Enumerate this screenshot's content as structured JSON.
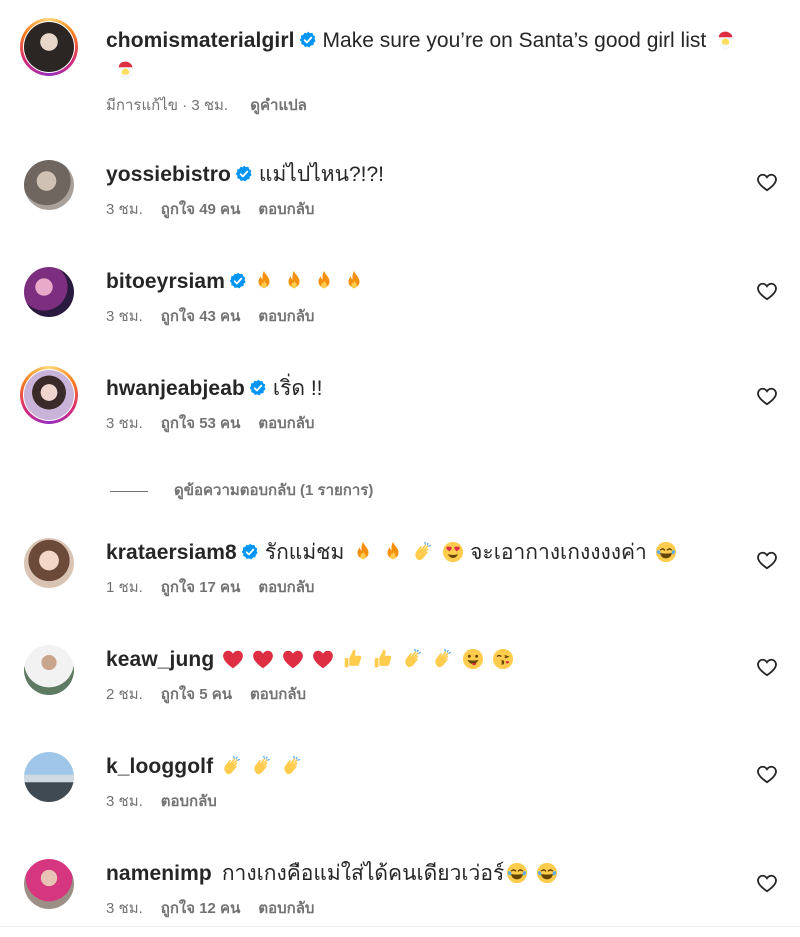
{
  "caption": {
    "username": "chomismaterialgirl",
    "text": "Make sure you’re on Santa’s good girl list",
    "edited": "มีการแก้ไข · 3 ชม.",
    "translate": "ดูคำแปล"
  },
  "comments": [
    {
      "username": "yossiebistro",
      "text": "แม่ไปไหน?!?!",
      "time": "3 ชม.",
      "likes": "ถูกใจ 49 คน",
      "reply": "ตอบกลับ",
      "verified": true
    },
    {
      "username": "bitoeyrsiam",
      "text": "",
      "time": "3 ชม.",
      "likes": "ถูกใจ 43 คน",
      "reply": "ตอบกลับ",
      "verified": true
    },
    {
      "username": "hwanjeabjeab",
      "text": "เริ่ด !!",
      "time": "3 ชม.",
      "likes": "ถูกใจ 53 คน",
      "reply": "ตอบกลับ",
      "verified": true
    },
    {
      "username": "krataersiam8",
      "text_a": "รักแม่ชม",
      "text_b": "จะเอากางเกงงงงค่า",
      "time": "1 ชม.",
      "likes": "ถูกใจ 17 คน",
      "reply": "ตอบกลับ",
      "verified": true
    },
    {
      "username": "keaw_jung",
      "text": "",
      "time": "2 ชม.",
      "likes": "ถูกใจ 5 คน",
      "reply": "ตอบกลับ",
      "verified": false
    },
    {
      "username": "k_looggolf",
      "text": "",
      "time": "3 ชม.",
      "reply": "ตอบกลับ",
      "verified": false
    },
    {
      "username": "namenimp",
      "text": "กางเกงคือแม่ใส่ได้คนเดียวเว่อร์",
      "time": "3 ชม.",
      "likes": "ถูกใจ 12 คน",
      "reply": "ตอบกลับ",
      "verified": false
    }
  ],
  "view_replies": "ดูข้อความตอบกลับ (1 รายการ)",
  "colors": {
    "verified": "#0095f6",
    "meta": "#737373",
    "text": "#262626"
  }
}
